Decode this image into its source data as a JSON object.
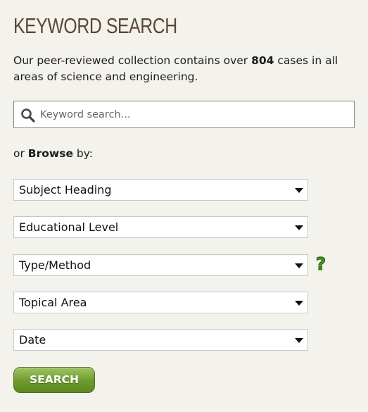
{
  "header": {
    "title": "KEYWORD SEARCH"
  },
  "intro": {
    "before": "Our peer-reviewed collection contains over ",
    "count": "804",
    "after": " cases in all areas of science and engineering."
  },
  "search": {
    "placeholder": "Keyword search...",
    "value": ""
  },
  "browse": {
    "prefix": "or ",
    "bold": "Browse",
    "suffix": " by:"
  },
  "filters": [
    {
      "label": "Subject Heading"
    },
    {
      "label": "Educational Level"
    },
    {
      "label": "Type/Method"
    },
    {
      "label": "Topical Area"
    },
    {
      "label": "Date"
    }
  ],
  "help_icon": "question-mark-icon",
  "search_button": {
    "label": "SEARCH"
  },
  "colors": {
    "background": "#f3f2ec",
    "title": "#5b4636",
    "button_green": "#6c9a2c",
    "help_green": "#3f9a1e"
  }
}
